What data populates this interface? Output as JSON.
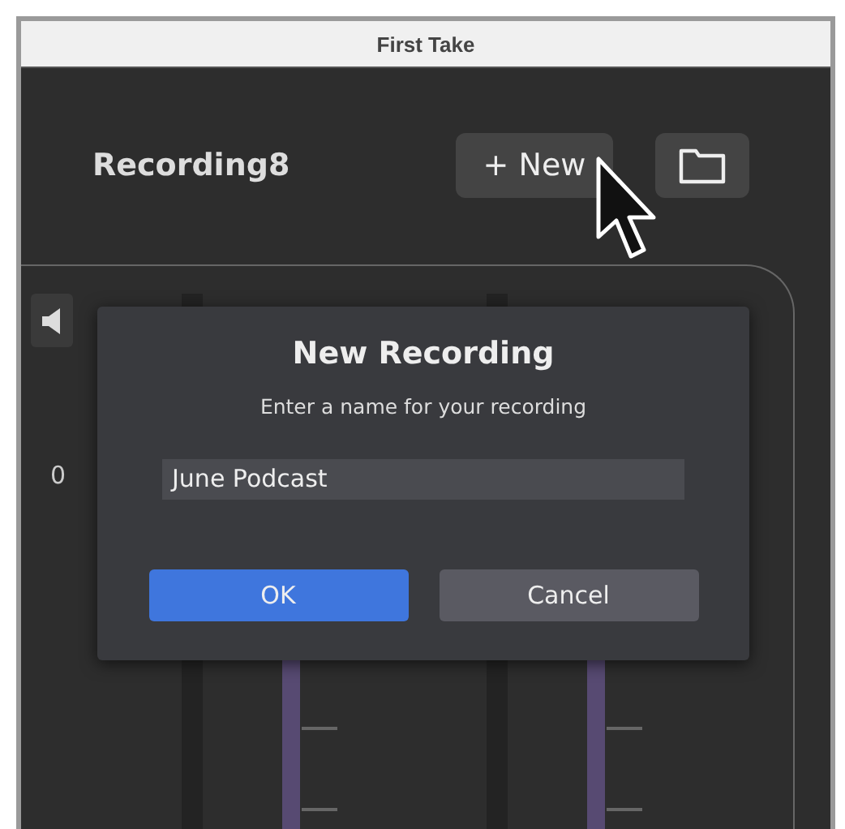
{
  "window": {
    "title": "First Take"
  },
  "header": {
    "title": "Recording8",
    "new_button": "+ New"
  },
  "mixer": {
    "volume_value": "0"
  },
  "dialog": {
    "title": "New Recording",
    "message": "Enter a name for your recording",
    "input": {
      "value": "June Podcast"
    },
    "buttons": [
      {
        "label": "OK",
        "kind": "primary"
      },
      {
        "label": "Cancel",
        "kind": "secondary"
      }
    ]
  }
}
